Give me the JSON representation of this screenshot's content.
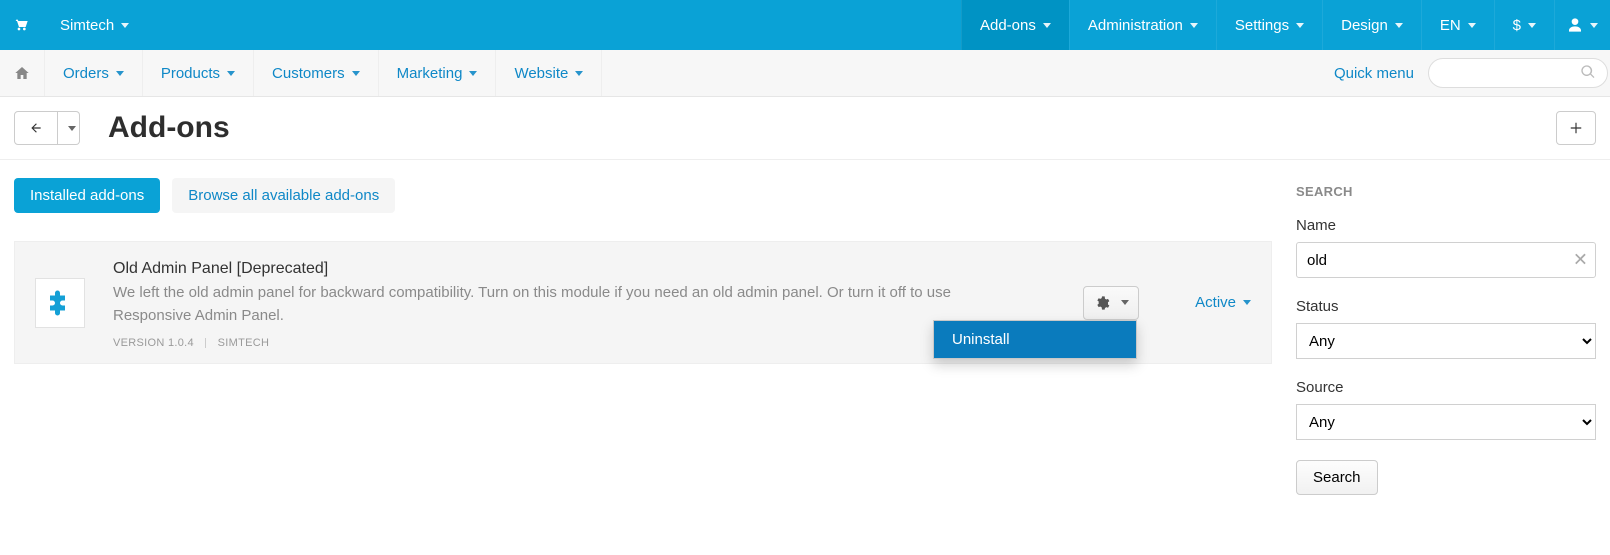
{
  "topbar": {
    "vendor": "Simtech",
    "right": [
      {
        "key": "addons",
        "label": "Add-ons",
        "active": true
      },
      {
        "key": "administration",
        "label": "Administration"
      },
      {
        "key": "settings",
        "label": "Settings"
      },
      {
        "key": "design",
        "label": "Design"
      },
      {
        "key": "lang",
        "label": "EN"
      },
      {
        "key": "currency",
        "label": "$"
      }
    ]
  },
  "nav": {
    "items": [
      {
        "key": "orders",
        "label": "Orders"
      },
      {
        "key": "products",
        "label": "Products"
      },
      {
        "key": "customers",
        "label": "Customers"
      },
      {
        "key": "marketing",
        "label": "Marketing"
      },
      {
        "key": "website",
        "label": "Website"
      }
    ],
    "quick_menu": "Quick menu"
  },
  "page_title": "Add-ons",
  "tabs": {
    "installed": "Installed add-ons",
    "browse": "Browse all available add-ons"
  },
  "addon": {
    "title": "Old Admin Panel [Deprecated]",
    "desc": "We left the old admin panel for backward compatibility. Turn on this module if you need an old admin panel. Or turn it off to use Responsive Admin Panel.",
    "version_label": "VERSION 1.0.4",
    "vendor_label": "SIMTECH",
    "status": "Active",
    "dropdown_items": [
      {
        "label": "Uninstall",
        "highlight": true
      }
    ]
  },
  "search_panel": {
    "heading": "SEARCH",
    "name_label": "Name",
    "name_value": "old",
    "status_label": "Status",
    "status_value": "Any",
    "source_label": "Source",
    "source_value": "Any",
    "button": "Search"
  }
}
